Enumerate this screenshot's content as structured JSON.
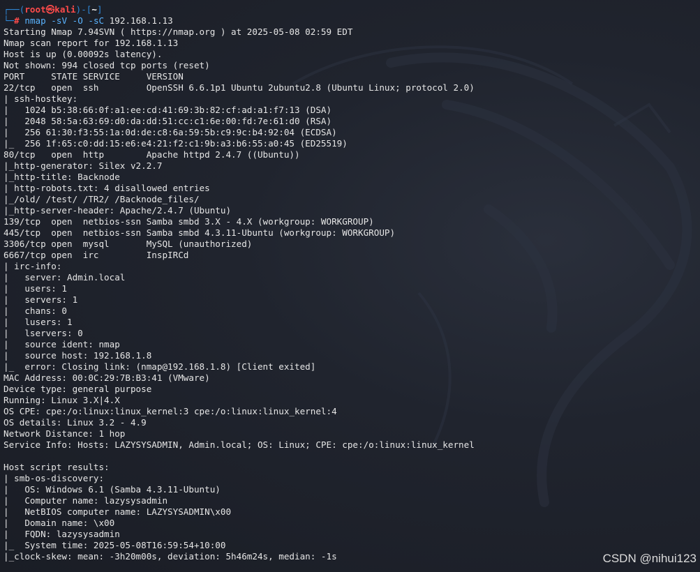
{
  "prompt": {
    "frame_top": "┌──(",
    "user": "root",
    "at": "㉿",
    "host": "kali",
    "frame_mid": ")-[",
    "dir": "~",
    "frame_end": "]",
    "frame_bottom": "└─",
    "hash": "#"
  },
  "command": {
    "name": "nmap",
    "flags": "-sV -O -sC",
    "target": "192.168.1.13"
  },
  "output": [
    "Starting Nmap 7.94SVN ( https://nmap.org ) at 2025-05-08 02:59 EDT",
    "Nmap scan report for 192.168.1.13",
    "Host is up (0.00092s latency).",
    "Not shown: 994 closed tcp ports (reset)",
    "PORT     STATE SERVICE     VERSION",
    "22/tcp   open  ssh         OpenSSH 6.6.1p1 Ubuntu 2ubuntu2.8 (Ubuntu Linux; protocol 2.0)",
    "| ssh-hostkey: ",
    "|   1024 b5:38:66:0f:a1:ee:cd:41:69:3b:82:cf:ad:a1:f7:13 (DSA)",
    "|   2048 58:5a:63:69:d0:da:dd:51:cc:c1:6e:00:fd:7e:61:d0 (RSA)",
    "|   256 61:30:f3:55:1a:0d:de:c8:6a:59:5b:c9:9c:b4:92:04 (ECDSA)",
    "|_  256 1f:65:c0:dd:15:e6:e4:21:f2:c1:9b:a3:b6:55:a0:45 (ED25519)",
    "80/tcp   open  http        Apache httpd 2.4.7 ((Ubuntu))",
    "|_http-generator: Silex v2.2.7",
    "|_http-title: Backnode",
    "| http-robots.txt: 4 disallowed entries ",
    "|_/old/ /test/ /TR2/ /Backnode_files/",
    "|_http-server-header: Apache/2.4.7 (Ubuntu)",
    "139/tcp  open  netbios-ssn Samba smbd 3.X - 4.X (workgroup: WORKGROUP)",
    "445/tcp  open  netbios-ssn Samba smbd 4.3.11-Ubuntu (workgroup: WORKGROUP)",
    "3306/tcp open  mysql       MySQL (unauthorized)",
    "6667/tcp open  irc         InspIRCd",
    "| irc-info: ",
    "|   server: Admin.local",
    "|   users: 1",
    "|   servers: 1",
    "|   chans: 0",
    "|   lusers: 1",
    "|   lservers: 0",
    "|   source ident: nmap",
    "|   source host: 192.168.1.8",
    "|_  error: Closing link: (nmap@192.168.1.8) [Client exited]",
    "MAC Address: 00:0C:29:7B:B3:41 (VMware)",
    "Device type: general purpose",
    "Running: Linux 3.X|4.X",
    "OS CPE: cpe:/o:linux:linux_kernel:3 cpe:/o:linux:linux_kernel:4",
    "OS details: Linux 3.2 - 4.9",
    "Network Distance: 1 hop",
    "Service Info: Hosts: LAZYSYSADMIN, Admin.local; OS: Linux; CPE: cpe:/o:linux:linux_kernel",
    "",
    "Host script results:",
    "| smb-os-discovery: ",
    "|   OS: Windows 6.1 (Samba 4.3.11-Ubuntu)",
    "|   Computer name: lazysysadmin",
    "|   NetBIOS computer name: LAZYSYSADMIN\\x00",
    "|   Domain name: \\x00",
    "|   FQDN: lazysysadmin",
    "|_  System time: 2025-05-08T16:59:54+10:00",
    "|_clock-skew: mean: -3h20m00s, deviation: 5h46m24s, median: -1s"
  ],
  "watermark": "CSDN @nihui123"
}
